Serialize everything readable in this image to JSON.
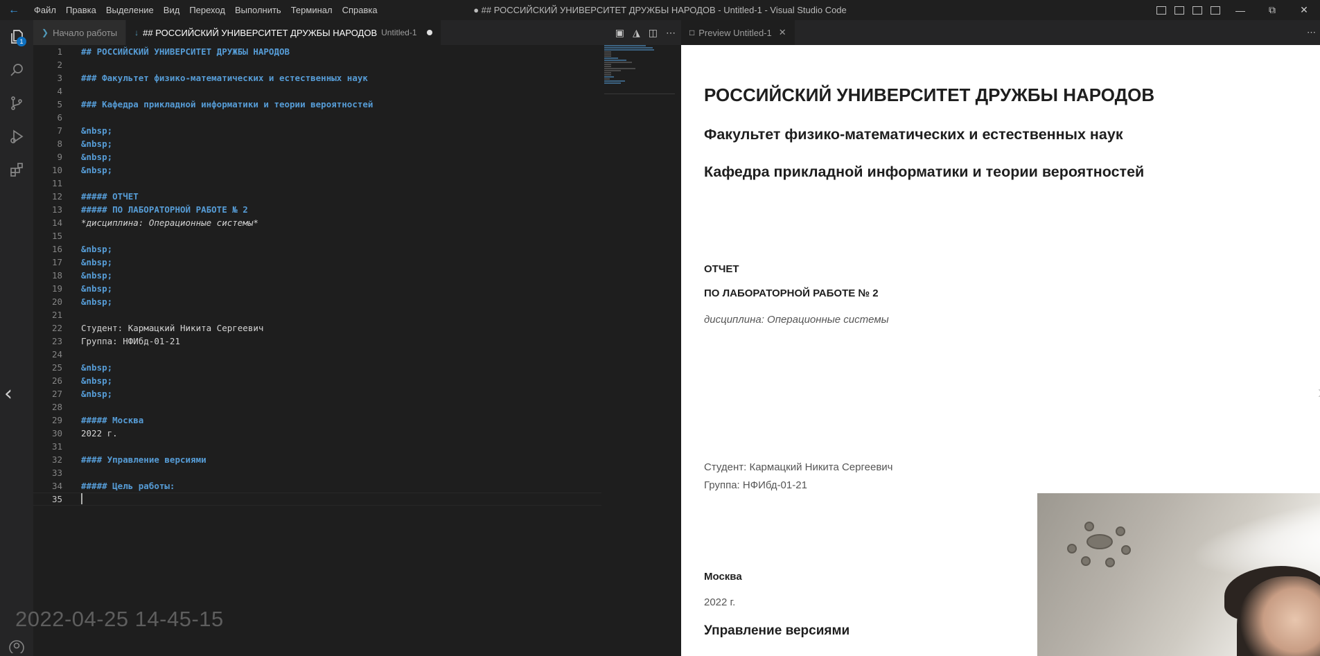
{
  "window": {
    "title": "● ## РОССИЙСКИЙ УНИВЕРСИТЕТ ДРУЖБЫ НАРОДОВ - Untitled-1 - Visual Studio Code",
    "menu": [
      "Файл",
      "Правка",
      "Выделение",
      "Вид",
      "Переход",
      "Выполнить",
      "Терминал",
      "Справка"
    ]
  },
  "activity_bar": {
    "items": [
      "explorer-icon",
      "search-icon",
      "source-control-icon",
      "run-debug-icon",
      "extensions-icon"
    ],
    "explorer_badge": "1"
  },
  "editor": {
    "tabs": [
      {
        "label": "Начало работы",
        "sub": "",
        "active": false,
        "icon": "vscode-icon"
      },
      {
        "label": "## РОССИЙСКИЙ УНИВЕРСИТЕТ ДРУЖБЫ НАРОДОВ",
        "sub": "Untitled-1",
        "active": true,
        "icon": "markdown-icon",
        "dirty": true
      }
    ],
    "lines": [
      {
        "n": "1",
        "text": "## РОССИЙСКИЙ УНИВЕРСИТЕТ ДРУЖБЫ НАРОДОВ",
        "style": "h"
      },
      {
        "n": "2",
        "text": "",
        "style": ""
      },
      {
        "n": "3",
        "text": "### Факультет физико-математических и естественных наук",
        "style": "h"
      },
      {
        "n": "4",
        "text": "",
        "style": ""
      },
      {
        "n": "5",
        "text": "### Кафедра прикладной информатики и теории вероятностей",
        "style": "h"
      },
      {
        "n": "6",
        "text": "",
        "style": ""
      },
      {
        "n": "7",
        "text": "&nbsp;",
        "style": "h"
      },
      {
        "n": "8",
        "text": "&nbsp;",
        "style": "h"
      },
      {
        "n": "9",
        "text": "&nbsp;",
        "style": "h"
      },
      {
        "n": "10",
        "text": "&nbsp;",
        "style": "h"
      },
      {
        "n": "11",
        "text": "",
        "style": ""
      },
      {
        "n": "12",
        "text": "##### ОТЧЕТ",
        "style": "h"
      },
      {
        "n": "13",
        "text": "##### ПО ЛАБОРАТОРНОЙ РАБОТЕ № 2",
        "style": "h"
      },
      {
        "n": "14",
        "text": "*дисциплина: Операционные системы*",
        "style": "em"
      },
      {
        "n": "15",
        "text": "",
        "style": ""
      },
      {
        "n": "16",
        "text": "&nbsp;",
        "style": "h"
      },
      {
        "n": "17",
        "text": "&nbsp;",
        "style": "h"
      },
      {
        "n": "18",
        "text": "&nbsp;",
        "style": "h"
      },
      {
        "n": "19",
        "text": "&nbsp;",
        "style": "h"
      },
      {
        "n": "20",
        "text": "&nbsp;",
        "style": "h"
      },
      {
        "n": "21",
        "text": "",
        "style": ""
      },
      {
        "n": "22",
        "text": "Студент: Кармацкий Никита Сергеевич",
        "style": ""
      },
      {
        "n": "23",
        "text": "Группа: НФИбд-01-21",
        "style": ""
      },
      {
        "n": "24",
        "text": "",
        "style": ""
      },
      {
        "n": "25",
        "text": "&nbsp;",
        "style": "h"
      },
      {
        "n": "26",
        "text": "&nbsp;",
        "style": "h"
      },
      {
        "n": "27",
        "text": "&nbsp;",
        "style": "h"
      },
      {
        "n": "28",
        "text": "",
        "style": ""
      },
      {
        "n": "29",
        "text": "##### Москва",
        "style": "h"
      },
      {
        "n": "30",
        "text": "2022 г.",
        "style": ""
      },
      {
        "n": "31",
        "text": "",
        "style": ""
      },
      {
        "n": "32",
        "text": "#### Управление версиями",
        "style": "h"
      },
      {
        "n": "33",
        "text": "",
        "style": ""
      },
      {
        "n": "34",
        "text": "##### Цель работы:",
        "style": "h"
      },
      {
        "n": "35",
        "text": "",
        "style": "cur"
      }
    ]
  },
  "preview": {
    "tab_label": "Preview Untitled-1",
    "h2": "РОССИЙСКИЙ УНИВЕРСИТЕТ ДРУЖБЫ НАРОДОВ",
    "h3a": "Факультет физико-математических и естественных наук",
    "h3b": "Кафедра прикладной информатики и теории вероятностей",
    "report": "ОТЧЕТ",
    "lab": "ПО ЛАБОРАТОРНОЙ РАБОТЕ № 2",
    "discipline": "дисциплина: Операционные системы",
    "student": "Студент: Кармацкий Никита Сергеевич",
    "group": "Группа: НФИбд-01-21",
    "city": "Москва",
    "year": "2022 г.",
    "section": "Управление версиями"
  },
  "overlay": {
    "timestamp": "2022-04-25 14-45-15"
  }
}
